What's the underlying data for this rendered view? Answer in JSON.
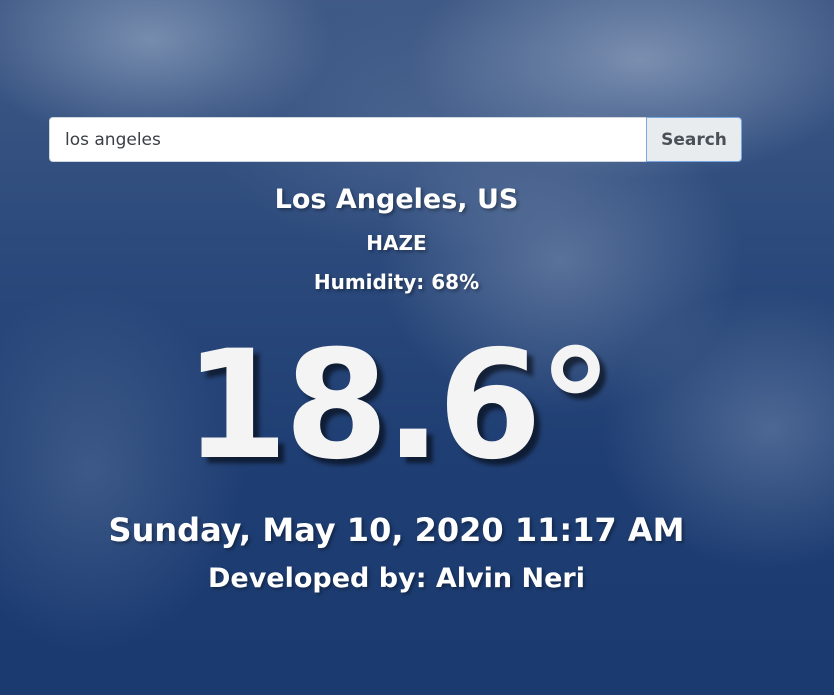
{
  "search": {
    "value": "los angeles",
    "button_label": "Search"
  },
  "weather": {
    "location": "Los Angeles, US",
    "condition": "HAZE",
    "humidity": "Humidity: 68%",
    "temperature": "18.6°"
  },
  "datetime": "Sunday, May 10, 2020 11:17 AM",
  "credit": "Developed by: Alvin Neri"
}
